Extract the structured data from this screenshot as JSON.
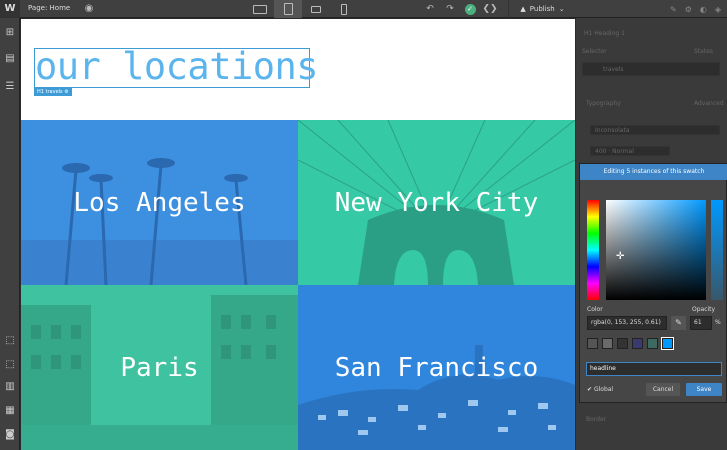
{
  "topbar": {
    "logo": "W",
    "page_label": "Page: Home",
    "publish_label": "Publish",
    "devices": [
      "desktop",
      "tablet",
      "mobile-landscape",
      "mobile-portrait"
    ]
  },
  "canvas": {
    "heading": "our locations",
    "tag": "H1 travels",
    "tiles": [
      {
        "label": "Los Angeles",
        "color": "#3d8fe0"
      },
      {
        "label": "New York City",
        "color": "#35c9a6"
      },
      {
        "label": "Paris",
        "color": "#3fc2a0"
      },
      {
        "label": "San Francisco",
        "color": "#2f86dc"
      }
    ]
  },
  "panel": {
    "element": "H1 Heading 1",
    "selector_label": "Selector",
    "states_label": "States",
    "selector_value": "travels",
    "typography_label": "Typography",
    "advanced_label": "Advanced",
    "font_value": "Inconsolata",
    "weight_value": "400 · Normal",
    "border_label": "Border"
  },
  "picker": {
    "banner": "Editing 5 instances of this swatch",
    "color_label": "Color",
    "opacity_label": "Opacity",
    "rgba_value": "rgba(0, 153, 255, 0.61)",
    "opacity_value": "61",
    "opacity_unit": "%",
    "swatch_name": "headline",
    "global_label": "Global",
    "cancel_label": "Cancel",
    "save_label": "Save",
    "swatches": [
      "#555555",
      "#6a6a6a",
      "#333333",
      "#3a3a70",
      "#3d6a60",
      "#0099ff"
    ]
  }
}
